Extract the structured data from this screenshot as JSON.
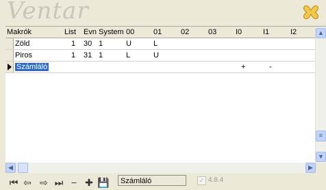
{
  "logo": {
    "text": "Ventar"
  },
  "columns": [
    "Makrók",
    "List",
    "Evn",
    "System",
    "00",
    "01",
    "02",
    "03",
    "I0",
    "I1",
    "I2"
  ],
  "rows": [
    {
      "c0": "Zöld",
      "c1": "1",
      "c2": "30",
      "c3": "1",
      "c4": "U",
      "c5": "L",
      "c6": "",
      "c7": "",
      "c8": "",
      "c9": "",
      "c10": ""
    },
    {
      "c0": "Piros",
      "c1": "1",
      "c2": "31",
      "c3": "1",
      "c4": "L",
      "c5": "U",
      "c6": "",
      "c7": "",
      "c8": "",
      "c9": "",
      "c10": ""
    },
    {
      "c0": "Számláló",
      "c1": "",
      "c2": "",
      "c3": "",
      "c4": "",
      "c5": "",
      "c6": "",
      "c7": "",
      "c8": "+",
      "c9": "-",
      "c10": ""
    }
  ],
  "toolbar": {
    "first_icon": "first-record-icon",
    "prev_icon": "prev-record-icon",
    "next_icon": "next-record-icon",
    "last_icon": "last-record-icon",
    "delete_icon": "delete-record-icon",
    "add_icon": "add-record-icon",
    "save_icon": "save-icon"
  },
  "status": {
    "field_value": "Számláló",
    "version": "4.8.4",
    "checked": true
  },
  "colors": {
    "selection": "#316ac5",
    "scroll_button": "#c1d3fb"
  }
}
